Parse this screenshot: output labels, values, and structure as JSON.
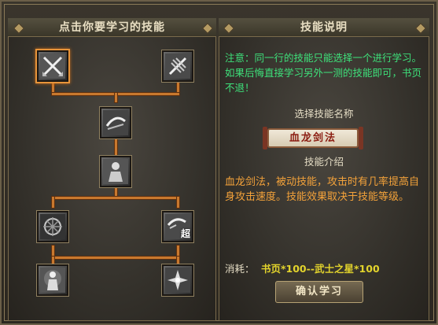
{
  "left_panel": {
    "title": "点击你要学习的技能"
  },
  "right_panel": {
    "title": "技能说明",
    "notice": "注意：同一行的技能只能选择一个进行学习。如果后悔直接学习另外一测的技能即可，书页不退！",
    "select_label": "选择技能名称",
    "selected_skill_name": "血龙剑法",
    "intro_label": "技能介绍",
    "description": "血龙剑法，被动技能，攻击时有几率提高自身攻击速度。技能效果取决于技能等级。",
    "cost_label": "消耗：",
    "cost_value": "书页*100--武士之星*100",
    "learn_button": "确认学习",
    "notice_color": "#3ee07a",
    "desc_color": "#f3a23a"
  },
  "skill_tree": {
    "nodes": [
      {
        "icon": "crossed-swords-icon",
        "selected": true
      },
      {
        "icon": "wing-blade-icon",
        "selected": false
      },
      {
        "icon": "slash-arc-icon",
        "selected": false
      },
      {
        "icon": "warrior-silhouette-icon",
        "selected": false
      },
      {
        "icon": "whirlwind-icon",
        "selected": false
      },
      {
        "icon": "super-strike-icon",
        "selected": false,
        "badge": "超"
      },
      {
        "icon": "warrior-aura-icon",
        "selected": false
      },
      {
        "icon": "star-burst-icon",
        "selected": false
      }
    ]
  }
}
